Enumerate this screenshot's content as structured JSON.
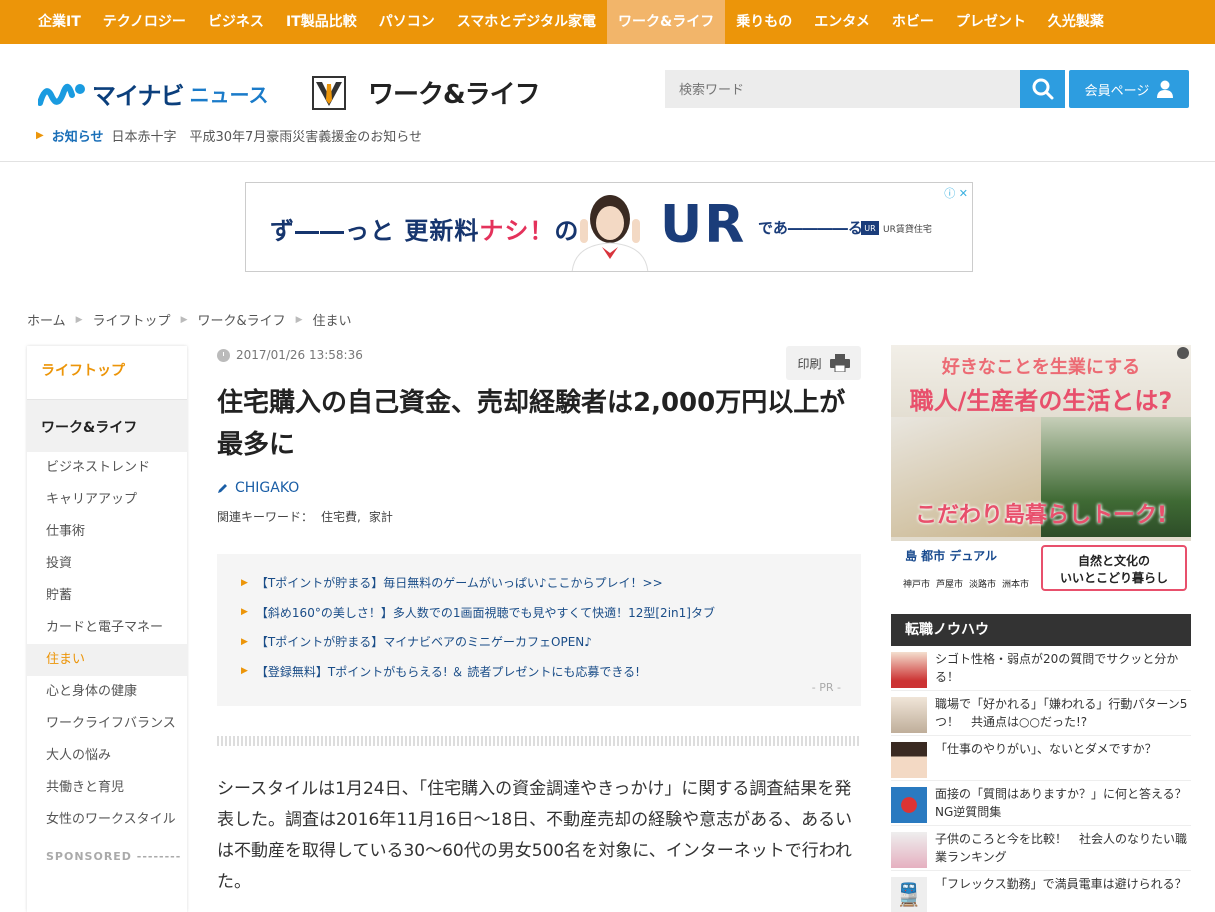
{
  "topnav": [
    "企業IT",
    "テクノロジー",
    "ビジネス",
    "IT製品比較",
    "パソコン",
    "スマホとデジタル家電",
    "ワーク&ライフ",
    "乗りもの",
    "エンタメ",
    "ホビー",
    "プレゼント",
    "久光製薬"
  ],
  "topnav_active_index": 6,
  "header": {
    "logo_main": "マイナビ",
    "logo_sub": "ニュース",
    "section_title": "ワーク&ライフ",
    "search_placeholder": "検索ワード",
    "member_label": "会員ページ",
    "notice_label": "お知らせ",
    "notice_text": "日本赤十字　平成30年7月豪雨災害義援金のお知らせ"
  },
  "banner": {
    "part1": "ず――っと 更新料",
    "part2": "ナシ！",
    "part3": "の",
    "big": "UR",
    "tail": "であ――――る。",
    "brand": "UR賃貸住宅",
    "brand_box": "UR"
  },
  "breadcrumb": [
    "ホーム",
    "ライフトップ",
    "ワーク&ライフ",
    "住まい"
  ],
  "sidebar": {
    "top": "ライフトップ",
    "category": "ワーク&ライフ",
    "items": [
      "ビジネストレンド",
      "キャリアアップ",
      "仕事術",
      "投資",
      "貯蓄",
      "カードと電子マネー",
      "住まい",
      "心と身体の健康",
      "ワークライフバランス",
      "大人の悩み",
      "共働きと育児",
      "女性のワークスタイル"
    ],
    "active_index": 6,
    "sponsored": "SPONSORED --------"
  },
  "article": {
    "date": "2017/01/26 13:58:36",
    "print_label": "印刷",
    "title": "住宅購入の自己資金、売却経験者は2,000万円以上が最多に",
    "author": "CHIGAKO",
    "keywords_label": "関連キーワード：",
    "keywords": [
      "住宅費,",
      "家計"
    ],
    "pr_items": [
      "【Tポイントが貯まる】毎日無料のゲームがいっぱい♪ここからプレイ！>>",
      "【斜め160°の美しさ！】多人数での1画面視聴でも見やすくて快適！12型[2in1]タブ",
      "【Tポイントが貯まる】マイナビベアのミニゲーカフェOPEN♪",
      "【登録無料】Tポイントがもらえる! ＆ 読者プレゼントにも応募できる!"
    ],
    "pr_label": "- PR -",
    "body": "シースタイルは1月24日、「住宅購入の資金調達やきっかけ」に関する調査結果を発表した。調査は2016年11月16日～18日、不動産売却の経験や意志がある、あるいは不動産を取得している30～60代の男女500名を対象に、インターネットで行われた。"
  },
  "right_ad": {
    "head1": "好きなことを生業にする",
    "head2": "職人/生産者の生活とは?",
    "bottom": "こだわり島暮らしトーク!",
    "dual": "島 都市 デュアル",
    "cities": [
      "神戸市",
      "芦屋市",
      "淡路市",
      "洲本市"
    ],
    "callout_line1": "自然と文化の",
    "callout_line2": "いいとこどり暮らし"
  },
  "ranking": {
    "title": "転職ノウハウ",
    "items": [
      "シゴト性格・弱点が20の質問でサクッと分かる！",
      "職場で「好かれる」「嫌われる」行動パターン5つ！　共通点は○○だった!?",
      "「仕事のやりがい」、ないとダメですか？",
      "面接の「質問はありますか？」に何と答える？　NG逆質問集",
      "子供のころと今を比較！　社会人のなりたい職業ランキング",
      "「フレックス勤務」で満員電車は避けられる？"
    ]
  },
  "colors": {
    "brand_orange": "#ec9509",
    "accent_blue": "#2d9de0",
    "link_blue": "#1a4d88"
  }
}
